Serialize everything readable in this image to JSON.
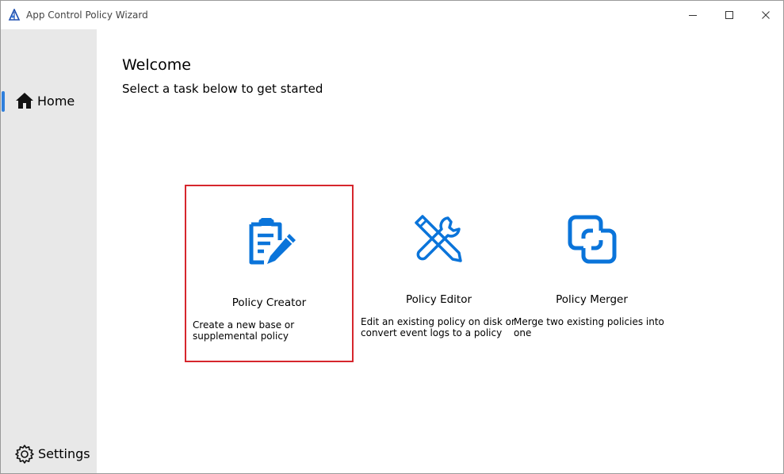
{
  "window": {
    "title": "App Control Policy Wizard",
    "accent_color": "#0a74da",
    "selection_color": "#d6262d"
  },
  "sidebar": {
    "items": [
      {
        "label": "Home",
        "icon": "home-icon",
        "selected": true
      },
      {
        "label": "Settings",
        "icon": "gear-icon",
        "selected": false
      }
    ]
  },
  "main": {
    "title": "Welcome",
    "subtitle": "Select a task below to get started",
    "cards": [
      {
        "title": "Policy Creator",
        "description": "Create a new base or supplemental policy",
        "icon": "clipboard-pencil-icon",
        "selected": true
      },
      {
        "title": "Policy Editor",
        "description": "Edit an existing policy on disk or convert event logs to a policy",
        "icon": "tools-icon",
        "selected": false
      },
      {
        "title": "Policy Merger",
        "description": "Merge two existing policies into one",
        "icon": "merge-icon",
        "selected": false
      }
    ]
  }
}
